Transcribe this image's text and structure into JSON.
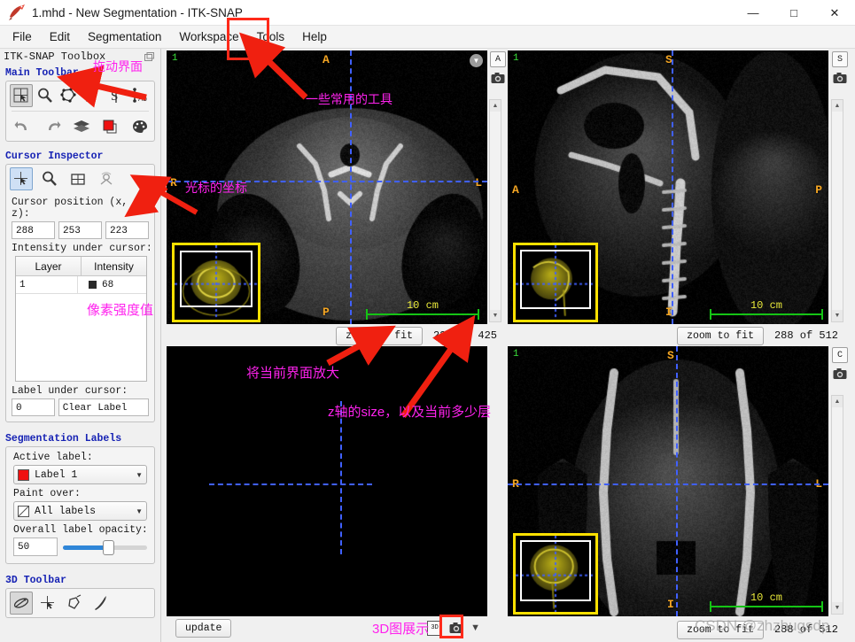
{
  "window": {
    "title": "1.mhd - New Segmentation - ITK-SNAP",
    "minimize": "—",
    "maximize": "□",
    "close": "✕"
  },
  "menubar": {
    "items": [
      {
        "label": "File"
      },
      {
        "label": "Edit"
      },
      {
        "label": "Segmentation"
      },
      {
        "label": "Workspace"
      },
      {
        "label": "Tools"
      },
      {
        "label": "Help"
      }
    ]
  },
  "toolbox": {
    "title": "ITK-SNAP Toolbox",
    "float_icon": "float-window-icon",
    "main_toolbar": {
      "title": "Main Toolbar",
      "row1": [
        {
          "name": "crosshair-tool",
          "active": true
        },
        {
          "name": "zoom-pan-tool",
          "active": false
        },
        {
          "name": "polygon-tool",
          "active": false
        },
        {
          "name": "paintbrush-tool",
          "active": false
        },
        {
          "name": "snake-tool",
          "active": false
        },
        {
          "name": "annotation-tool",
          "active": false
        }
      ],
      "row2": [
        {
          "name": "undo-tool",
          "active": false
        },
        {
          "name": "redo-tool",
          "active": false
        },
        {
          "name": "layers-tool",
          "active": false
        },
        {
          "name": "label-color-tool",
          "active": false
        },
        {
          "name": "palette-tool",
          "active": false
        }
      ]
    },
    "cursor_inspector": {
      "title": "Cursor Inspector",
      "tabs": [
        {
          "name": "cursor-tab",
          "active": true
        },
        {
          "name": "zoom-tab",
          "active": false
        },
        {
          "name": "grid-tab",
          "active": false
        },
        {
          "name": "ray-tab",
          "active": false
        }
      ],
      "position_label": "Cursor position (x, y, z):",
      "position": {
        "x": "288",
        "y": "253",
        "z": "223"
      },
      "intensity_label": "Intensity under cursor:",
      "intensity_table": {
        "columns": [
          "Layer",
          "Intensity"
        ],
        "rows": [
          {
            "layer": "1",
            "intensity": "68",
            "swatch": "#2a2a2a"
          }
        ]
      },
      "label_under_cursor_label": "Label under cursor:",
      "label_index": "0",
      "label_name": "Clear Label"
    },
    "segmentation_labels": {
      "title": "Segmentation Labels",
      "active_label_caption": "Active label:",
      "active_label_value": "Label 1",
      "active_label_color": "#ef1010",
      "paint_over_caption": "Paint over:",
      "paint_over_value": "All labels",
      "opacity_caption": "Overall label opacity:",
      "opacity_value": "50",
      "dropdown_arrow": "▼"
    },
    "toolbar_3d": {
      "title": "3D Toolbar",
      "buttons": [
        {
          "name": "trackball-3d-tool",
          "active": true
        },
        {
          "name": "crosshair-3d-tool",
          "active": false
        },
        {
          "name": "spraypaint-3d-tool",
          "active": false
        },
        {
          "name": "scalpel-3d-tool",
          "active": false
        }
      ]
    }
  },
  "panels": {
    "axial": {
      "slice_index": "1",
      "orient_top": "A",
      "orient_bottom": "P",
      "orient_left": "R",
      "orient_right": "L",
      "ruler": "10 cm",
      "rail_letter": "A",
      "camera_icon": "camera-icon",
      "chevron_icon": "chevron-down-icon",
      "zoom_to_fit": "zoom to fit",
      "slice_counter": "223 of 425"
    },
    "sagittal": {
      "slice_index": "1",
      "orient_top": "S",
      "orient_bottom": "I",
      "orient_left": "A",
      "orient_right": "P",
      "ruler": "10 cm",
      "rail_letter": "S",
      "camera_icon": "camera-icon",
      "zoom_to_fit": "zoom to fit",
      "slice_counter": "288 of 512"
    },
    "coronal": {
      "slice_index": "1",
      "orient_top": "S",
      "orient_bottom": "I",
      "orient_left": "R",
      "orient_right": "L",
      "ruler": "10 cm",
      "rail_letter": "C",
      "camera_icon": "camera-icon",
      "zoom_to_fit": "zoom to fit",
      "slice_counter": "288 of 512"
    },
    "view3d": {
      "update_button": "update",
      "icon_3d": "3D",
      "camera_icon": "camera-icon",
      "chevron_icon": "chevron-down-icon"
    }
  },
  "annotations": {
    "drag_ui": "拖动界面",
    "common_tools": "一些常用的工具",
    "cursor_coords": "光标的坐标",
    "pixel_intensity": "像素强度值",
    "zoom_current_view": "将当前界面放大",
    "z_axis_size": "z轴的size，以及当前多少层",
    "show_3d": "3D图展示"
  },
  "watermark": {
    "text": "CSDN @zhzhugsdp"
  },
  "colors": {
    "annotation": "#ff22ee",
    "highlight_box": "#ff2a1a",
    "arrow": "#f02010",
    "crosshair": "#4060ff",
    "ruler": "#15c415",
    "slice_number": "#3ae03a",
    "orientation": "#f5a623",
    "section_title": "#1622b4",
    "thumbnail_border": "#ffe100"
  }
}
